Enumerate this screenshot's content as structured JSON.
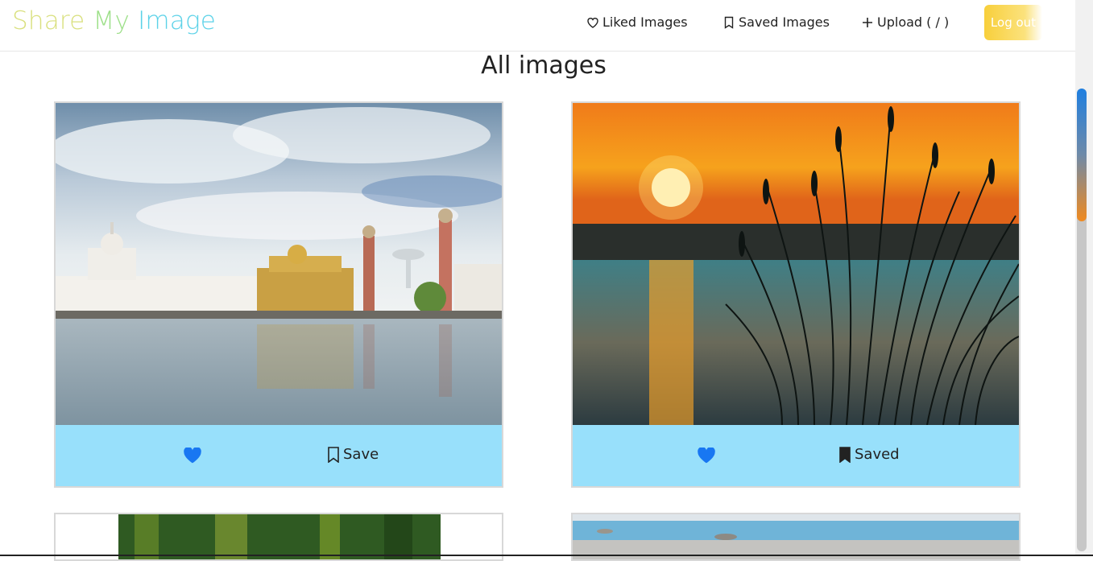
{
  "app": {
    "brand": {
      "part1": "Share ",
      "part2": "My ",
      "part3": "Image"
    },
    "nav": {
      "liked": "Liked Images",
      "saved": "Saved Images",
      "upload": "Upload ( / )",
      "logout": "Log out"
    }
  },
  "page": {
    "title": "All images"
  },
  "cards": [
    {
      "save_label": "Save",
      "saved": false,
      "liked": true,
      "image": "golden-temple-photo"
    },
    {
      "save_label": "Saved",
      "saved": true,
      "liked": true,
      "image": "sunset-lake-reeds-photo"
    },
    {
      "image": "green-foliage-photo"
    },
    {
      "image": "beach-shoreline-photo"
    }
  ],
  "colors": {
    "brand_gradient": [
      "#d4e08a",
      "#8fe08a",
      "#5ad0ea"
    ],
    "card_footer": "#98e0fb",
    "heart": "#1877f2",
    "logout_bg": "#f8cf3b"
  }
}
